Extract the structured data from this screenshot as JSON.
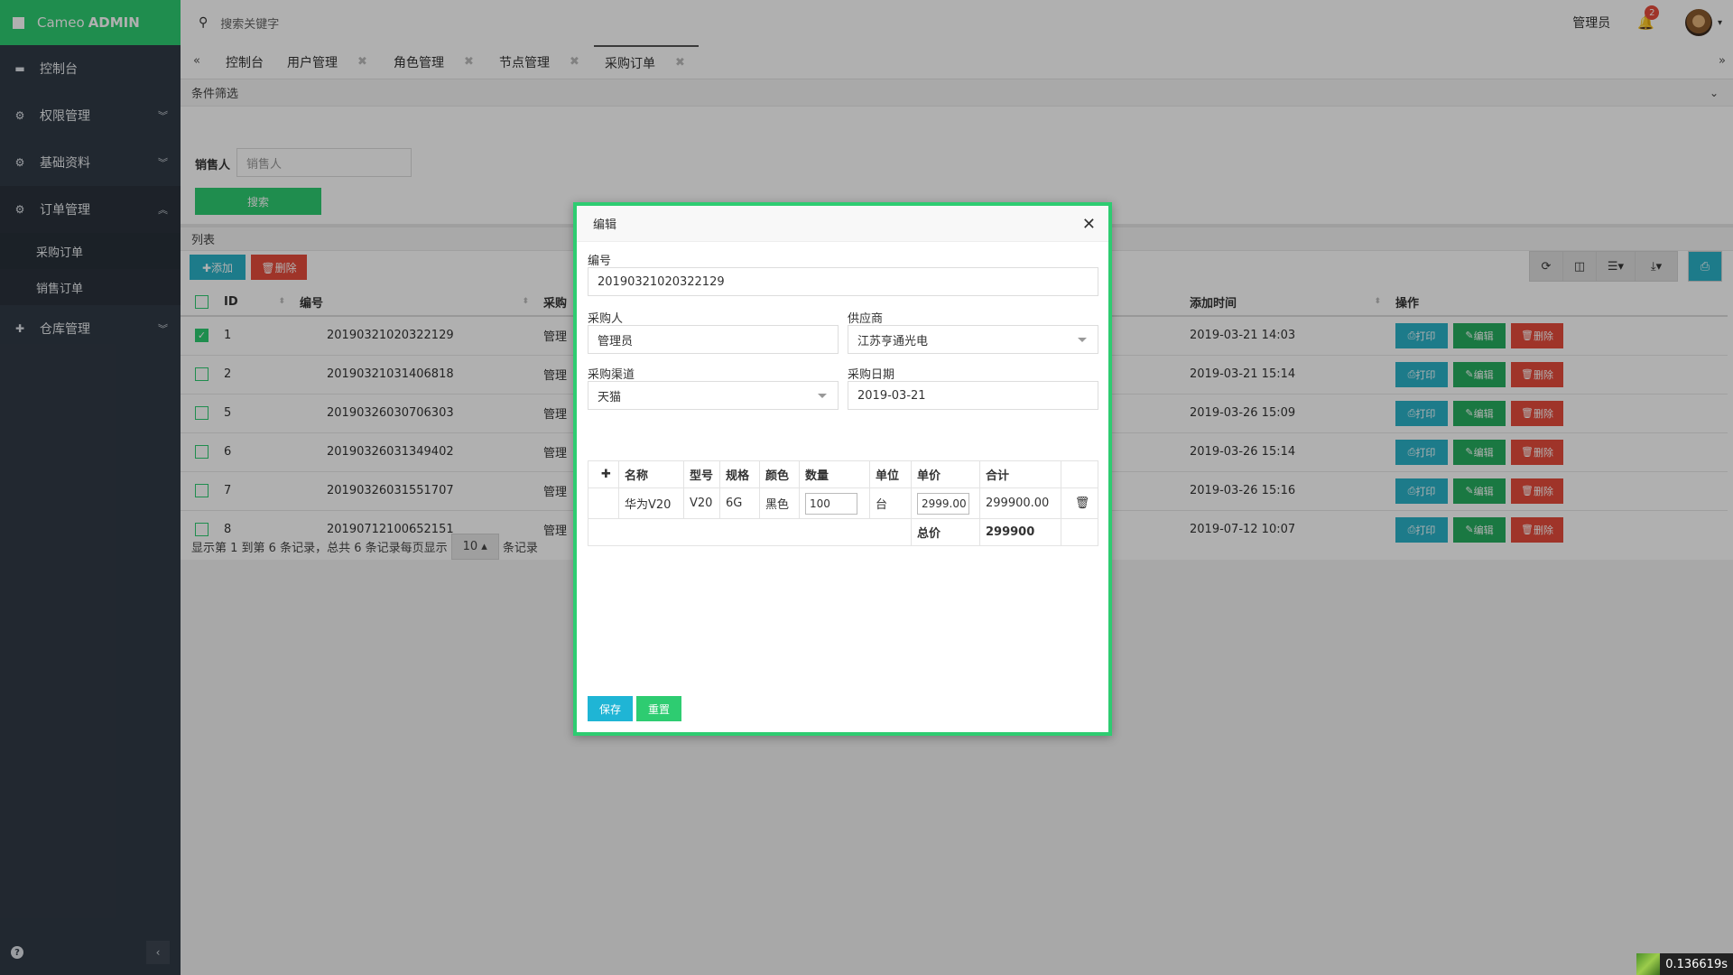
{
  "brand": {
    "name": "Cameo",
    "suffix": "ADMIN"
  },
  "sidebar": {
    "items": [
      {
        "label": "控制台",
        "icon": "dashboard-icon"
      },
      {
        "label": "权限管理",
        "icon": "cogs-icon"
      },
      {
        "label": "基础资料",
        "icon": "cogs-icon"
      },
      {
        "label": "订单管理",
        "icon": "cogs-icon"
      },
      {
        "label": "仓库管理",
        "icon": "plus-icon"
      }
    ],
    "sub_items": [
      "采购订单",
      "销售订单"
    ]
  },
  "topbar": {
    "search_placeholder": "搜索关键字",
    "user": "管理员",
    "notifications": "2"
  },
  "tabs": [
    "控制台",
    "用户管理",
    "角色管理",
    "节点管理",
    "采购订单"
  ],
  "filter": {
    "title": "条件筛选",
    "seller_label": "销售人",
    "seller_placeholder": "销售人",
    "search_button": "搜索"
  },
  "list": {
    "title": "列表",
    "add_button": "✚添加",
    "delete_button": "🗑删除",
    "columns": [
      "ID",
      "编号",
      "采购",
      "添加时间",
      "操作"
    ],
    "rows": [
      {
        "id": "1",
        "code": "20190321020322129",
        "buyer": "管理",
        "time": "2019-03-21 14:03",
        "checked": true
      },
      {
        "id": "2",
        "code": "20190321031406818",
        "buyer": "管理",
        "time": "2019-03-21 15:14",
        "checked": false
      },
      {
        "id": "5",
        "code": "20190326030706303",
        "buyer": "管理",
        "time": "2019-03-26 15:09",
        "checked": false
      },
      {
        "id": "6",
        "code": "20190326031349402",
        "buyer": "管理",
        "time": "2019-03-26 15:14",
        "checked": false
      },
      {
        "id": "7",
        "code": "20190326031551707",
        "buyer": "管理",
        "time": "2019-03-26 15:16",
        "checked": false
      },
      {
        "id": "8",
        "code": "20190712100652151",
        "buyer": "管理",
        "time": "2019-07-12 10:07",
        "checked": false
      }
    ],
    "op_print": "打印",
    "op_edit": "编辑",
    "op_delete": "删除",
    "pager_text": "显示第 1 到第 6 条记录，总共 6 条记录每页显示",
    "page_size": "10 ▴",
    "pager_suffix": "条记录"
  },
  "modal": {
    "title": "编辑",
    "code_label": "编号",
    "code_value": "20190321020322129",
    "buyer_label": "采购人",
    "buyer_value": "管理员",
    "supplier_label": "供应商",
    "supplier_value": "江苏亨通光电",
    "channel_label": "采购渠道",
    "channel_value": "天猫",
    "date_label": "采购日期",
    "date_value": "2019-03-21",
    "item_headers": [
      "名称",
      "型号",
      "规格",
      "颜色",
      "数量",
      "单位",
      "单价",
      "合计"
    ],
    "item": {
      "name": "华为V20",
      "model": "V20",
      "spec": "6G",
      "color": "黑色",
      "qty": "100",
      "unit": "台",
      "price": "2999.00",
      "total": "299900.00"
    },
    "total_label": "总价",
    "total_value": "299900",
    "save_button": "保存",
    "reset_button": "重置"
  },
  "status_timer": "0.136619s"
}
